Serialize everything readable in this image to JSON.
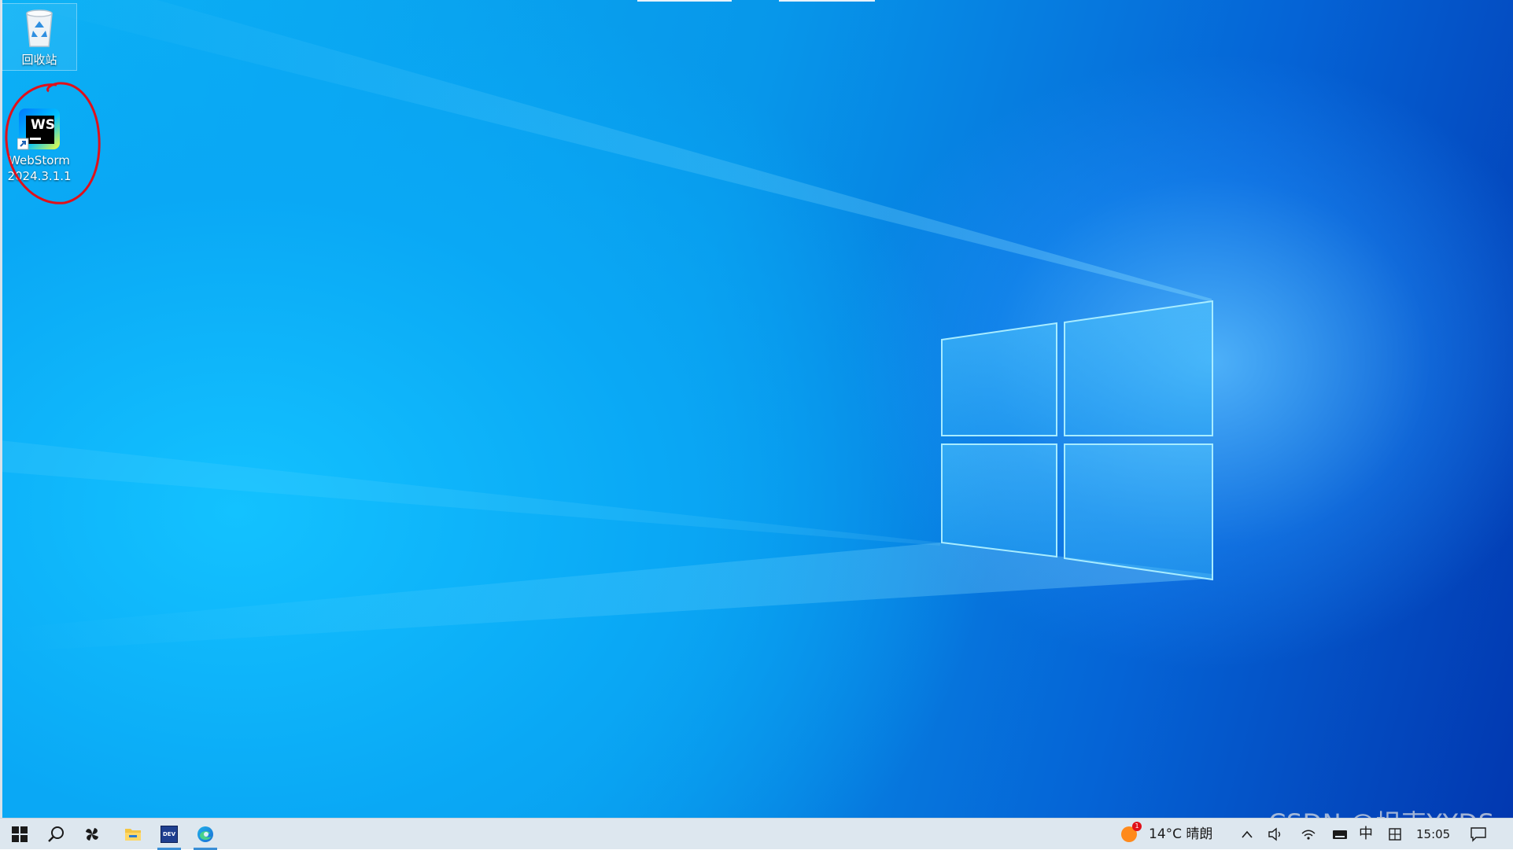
{
  "desktop": {
    "icons": [
      {
        "label": "回收站",
        "icon": "recycle-bin-icon"
      },
      {
        "label": "WebStorm\n2024.3.1.1",
        "icon": "webstorm-icon",
        "badge": "WS"
      }
    ],
    "wallpaper": "windows-logo-wallpaper",
    "colors": {
      "accent": "#0aa8f5",
      "deep": "#0238b0",
      "annotation": "#e0101a"
    }
  },
  "taskbar": {
    "buttons": [
      {
        "name": "start",
        "icon": "windows-start-icon"
      },
      {
        "name": "search",
        "icon": "search-icon"
      },
      {
        "name": "app-pinwheel",
        "icon": "pinwheel-app-icon"
      },
      {
        "name": "file-explorer",
        "icon": "folder-icon"
      },
      {
        "name": "devtool",
        "icon": "devtool-app-icon",
        "badge": "DEV"
      },
      {
        "name": "edge",
        "icon": "edge-browser-icon"
      }
    ],
    "tray": {
      "weather_badge": "1",
      "weather": "14°C  晴朗",
      "ime": "中",
      "time": "15:05",
      "icons": [
        "chevron-up-icon",
        "speaker-icon",
        "network-icon",
        "keyboard-icon",
        "ime-mode-icon",
        "notification-icon"
      ]
    }
  },
  "watermark": "CSDN @坦克YYDS"
}
